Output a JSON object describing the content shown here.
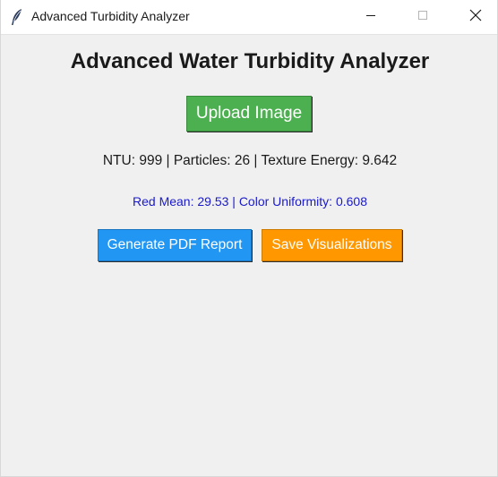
{
  "window": {
    "title": "Advanced Turbidity Analyzer",
    "icon": "feather-icon"
  },
  "controls": {
    "minimize_icon": "minimize-icon",
    "maximize_icon": "maximize-icon",
    "close_icon": "close-icon"
  },
  "main": {
    "heading": "Advanced Water Turbidity Analyzer",
    "upload_label": "Upload Image",
    "metrics_text": "NTU: 999 | Particles: 26 | Texture Energy: 9.642",
    "color_text": "Red Mean: 29.53 | Color Uniformity: 0.608",
    "pdf_label": "Generate PDF Report",
    "viz_label": "Save Visualizations"
  },
  "colors": {
    "upload_button": "#4caf50",
    "pdf_button": "#2196f3",
    "viz_button": "#ff9800",
    "color_text": "#1a1acc",
    "background": "#f0f0f0"
  }
}
